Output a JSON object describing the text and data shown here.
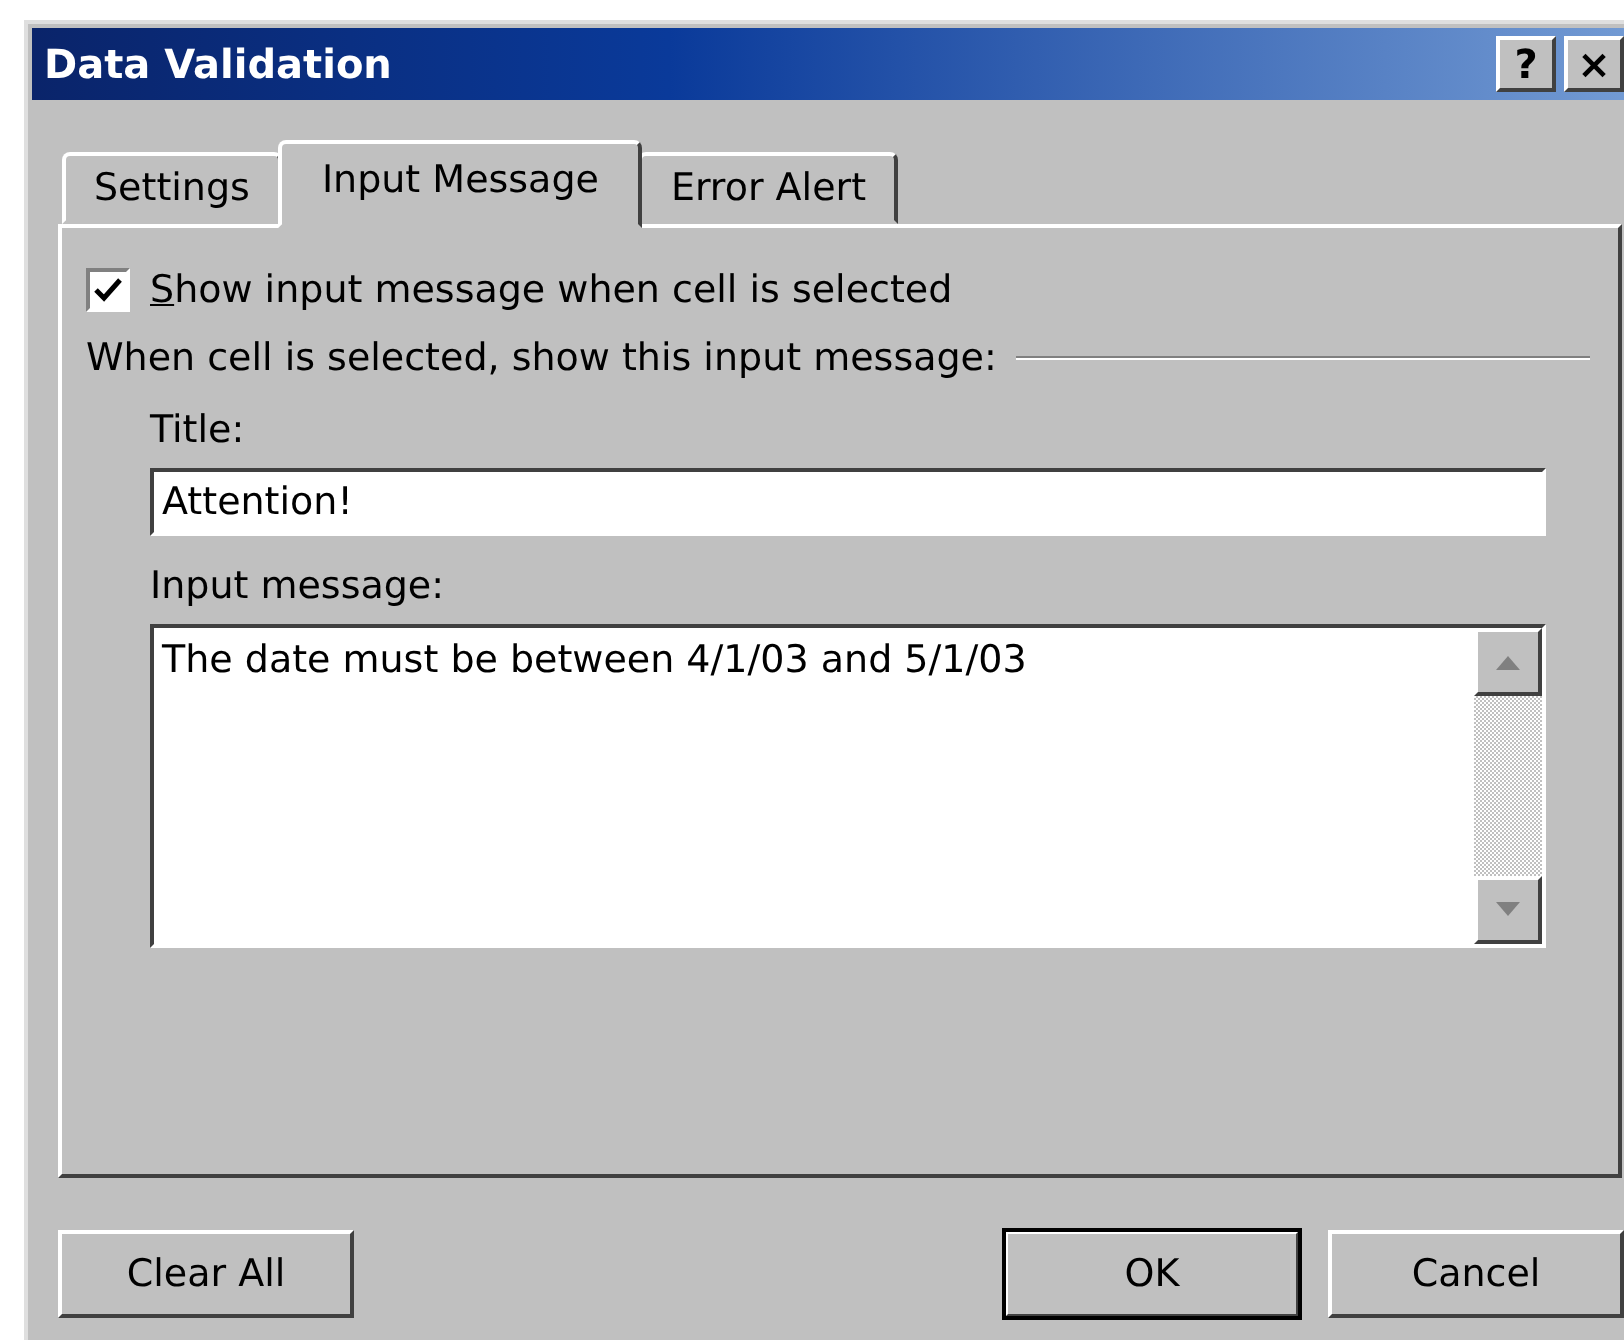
{
  "window": {
    "title": "Data Validation",
    "title_buttons": [
      "?",
      "×"
    ]
  },
  "tabs": [
    {
      "label": "Settings",
      "selected": false
    },
    {
      "label": "Input Message",
      "selected": true
    },
    {
      "label": "Error Alert",
      "selected": false
    }
  ],
  "show_checkbox": {
    "label": "Show input message when cell is selected",
    "checked": true
  },
  "group_label": "When cell is selected, show this input message:",
  "title_field": {
    "label": "Title:",
    "value": "Attention!"
  },
  "message_field": {
    "label": "Input message:",
    "value": "The date must be between 4/1/03 and 5/1/03"
  },
  "buttons": [
    {
      "kind": "left",
      "label": "Clear All",
      "default": false
    },
    {
      "kind": "right",
      "label": "OK",
      "default": true
    },
    {
      "kind": "right",
      "label": "Cancel",
      "default": false
    }
  ]
}
